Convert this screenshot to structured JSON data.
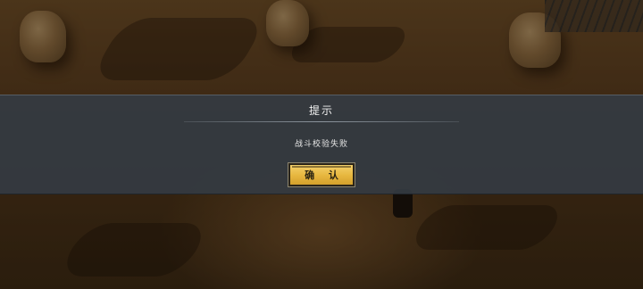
{
  "dialog": {
    "title": "提示",
    "message": "战斗校验失败",
    "confirm_label": "确 认"
  }
}
